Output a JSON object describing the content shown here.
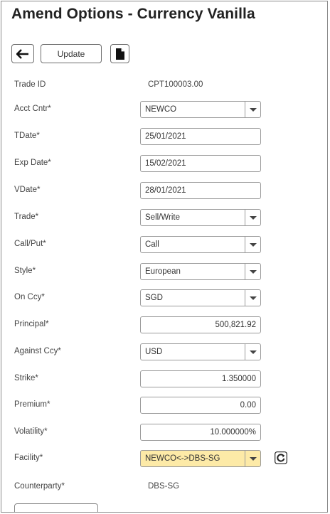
{
  "title": "Amend Options - Currency Vanilla",
  "toolbar": {
    "back_icon": "arrow-left-icon",
    "update_label": "Update",
    "document_icon": "document-icon"
  },
  "fields": {
    "trade_id": {
      "label": "Trade ID",
      "value": "CPT100003.00"
    },
    "acct_cntr": {
      "label": "Acct Cntr*",
      "value": "NEWCO"
    },
    "tdate": {
      "label": "TDate*",
      "value": "25/01/2021"
    },
    "exp_date": {
      "label": "Exp Date*",
      "value": "15/02/2021"
    },
    "vdate": {
      "label": "VDate*",
      "value": "28/01/2021"
    },
    "trade": {
      "label": "Trade*",
      "value": "Sell/Write"
    },
    "call_put": {
      "label": "Call/Put*",
      "value": "Call"
    },
    "style": {
      "label": "Style*",
      "value": "European"
    },
    "on_ccy": {
      "label": "On Ccy*",
      "value": "SGD"
    },
    "principal": {
      "label": "Principal*",
      "value": "500,821.92"
    },
    "against_ccy": {
      "label": "Against Ccy*",
      "value": "USD"
    },
    "strike": {
      "label": "Strike*",
      "value": "1.350000"
    },
    "premium": {
      "label": "Premium*",
      "value": "0.00"
    },
    "volatility": {
      "label": "Volatility*",
      "value": "10.000000%"
    },
    "facility": {
      "label": "Facility*",
      "value": "NEWCO<->DBS-SG",
      "refresh_icon": "refresh-icon"
    },
    "counterparty": {
      "label": "Counterparty*",
      "value": "DBS-SG"
    }
  },
  "colors": {
    "facility_highlight": "#fdeaa7",
    "border": "#9a9a9a"
  }
}
